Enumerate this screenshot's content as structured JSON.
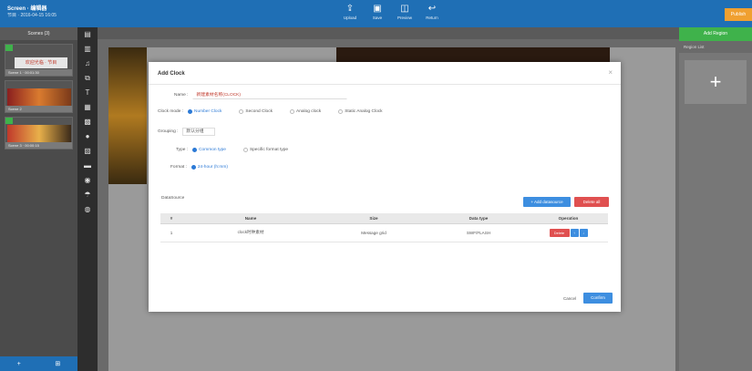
{
  "app": {
    "brand_line1": "Screen · 编辑器",
    "brand_line2": "节目 · 2016-04-15 16:05"
  },
  "topnav": [
    {
      "icon": "upload-icon",
      "glyph": "⇪",
      "label": "Upload"
    },
    {
      "icon": "save-icon",
      "glyph": "▣",
      "label": "Save"
    },
    {
      "icon": "preview-icon",
      "glyph": "◫",
      "label": "Preview"
    },
    {
      "icon": "back-icon",
      "glyph": "↩",
      "label": "Return"
    }
  ],
  "corner_button": "Publish",
  "left_panel": {
    "header": "Scenes (3)",
    "scene1_caption": "Scene 1 · 00:01:30",
    "scene1_thumb_text": "欢迎光临 · 节目",
    "scene2_caption": "Scene 2",
    "scene3_caption": "Scene 3 · 00:00:15",
    "footer_left": "+",
    "footer_right": "⊞"
  },
  "toolbar": [
    {
      "icon": "text-icon",
      "glyph": "▤"
    },
    {
      "icon": "image-icon",
      "glyph": "▥"
    },
    {
      "icon": "music-icon",
      "glyph": "♫"
    },
    {
      "icon": "copy-icon",
      "glyph": "⧉"
    },
    {
      "icon": "font-icon",
      "glyph": "T"
    },
    {
      "icon": "video-icon",
      "glyph": "▦"
    },
    {
      "icon": "table-icon",
      "glyph": "▩"
    },
    {
      "icon": "circle-icon",
      "glyph": "●"
    },
    {
      "icon": "document-icon",
      "glyph": "▧"
    },
    {
      "icon": "folder-icon",
      "glyph": "▬"
    },
    {
      "icon": "clock-icon",
      "glyph": "◉"
    },
    {
      "icon": "weather-icon",
      "glyph": "☂"
    },
    {
      "icon": "web-icon",
      "glyph": "◍"
    }
  ],
  "right_panel": {
    "add_button": "Add Region",
    "header": "Region List",
    "add_symbol": "+"
  },
  "modal": {
    "title": "Add Clock",
    "close": "×",
    "name_label": "Name :",
    "name_value": "新建素材名称(CLOCK)",
    "clock_mode_label": "Clock mode :",
    "clock_modes": [
      "Number Clock",
      "Second Clock",
      "Analog clock",
      "Static Analog Clock"
    ],
    "clock_mode_selected": 0,
    "grouping_label": "Grouping :",
    "grouping_value": "默认分组",
    "type_label": "Type :",
    "types": [
      "Common type",
      "Specific format type"
    ],
    "type_selected": 0,
    "format_label": "Format :",
    "format_value": "24-hour (h:mm)",
    "data_label": "DataSource",
    "add_datasource_button": "+ Add datasource",
    "delete_all_button": "Delete all",
    "table": {
      "headers": [
        "#",
        "Name",
        "Size",
        "Data type",
        "Operation"
      ],
      "rows": [
        {
          "index": "1",
          "name": "clock时钟素材",
          "size": "Message grid",
          "type": "SWF/FLASH",
          "delete": "Delete",
          "up": "↑",
          "down": "↓"
        }
      ]
    },
    "cancel_button": "Cancel",
    "confirm_button": "Confirm"
  },
  "colors": {
    "topbar": "#1f6fb5",
    "accent_blue": "#3d8ee0",
    "danger_red": "#e05050",
    "success_green": "#3fb24b",
    "warning_orange": "#f0a030"
  }
}
